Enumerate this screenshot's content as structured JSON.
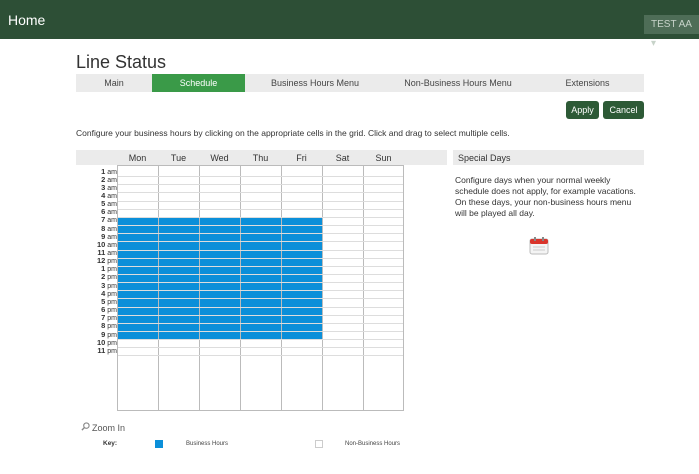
{
  "topbar": {
    "home": "Home",
    "user_menu": "TEST AA",
    "user_menu_caret": "▾"
  },
  "page": {
    "title": "Line Status"
  },
  "tabs": [
    {
      "label": "Main",
      "active": false
    },
    {
      "label": "Schedule",
      "active": true
    },
    {
      "label": "Business Hours Menu",
      "active": false
    },
    {
      "label": "Non-Business Hours Menu",
      "active": false
    },
    {
      "label": "Extensions",
      "active": false
    }
  ],
  "actions": {
    "apply": "Apply",
    "cancel": "Cancel"
  },
  "instructions": "Configure your business hours by clicking on the appropriate cells in the grid. Click and drag to select multiple cells.",
  "schedule": {
    "days": [
      "Mon",
      "Tue",
      "Wed",
      "Thu",
      "Fri",
      "Sat",
      "Sun"
    ],
    "hours": [
      {
        "n": "1",
        "s": "am"
      },
      {
        "n": "2",
        "s": "am"
      },
      {
        "n": "3",
        "s": "am"
      },
      {
        "n": "4",
        "s": "am"
      },
      {
        "n": "5",
        "s": "am"
      },
      {
        "n": "6",
        "s": "am"
      },
      {
        "n": "7",
        "s": "am"
      },
      {
        "n": "8",
        "s": "am"
      },
      {
        "n": "9",
        "s": "am"
      },
      {
        "n": "10",
        "s": "am"
      },
      {
        "n": "11",
        "s": "am"
      },
      {
        "n": "12",
        "s": "pm"
      },
      {
        "n": "1",
        "s": "pm"
      },
      {
        "n": "2",
        "s": "pm"
      },
      {
        "n": "3",
        "s": "pm"
      },
      {
        "n": "4",
        "s": "pm"
      },
      {
        "n": "5",
        "s": "pm"
      },
      {
        "n": "6",
        "s": "pm"
      },
      {
        "n": "7",
        "s": "pm"
      },
      {
        "n": "8",
        "s": "pm"
      },
      {
        "n": "9",
        "s": "pm"
      },
      {
        "n": "10",
        "s": "pm"
      },
      {
        "n": "11",
        "s": "pm"
      }
    ],
    "business_color": "#0b8fd9"
  },
  "special_days": {
    "title": "Special Days",
    "text": "Configure days when your normal weekly schedule does not apply, for example vacations. On these days, your non-business hours menu will be played all day.",
    "icon": "calendar-icon"
  },
  "zoom": {
    "label": "Zoom In",
    "icon": "magnifier-icon"
  },
  "key": {
    "label": "Key:",
    "business": "Business Hours",
    "non_business": "Non-Business Hours"
  },
  "colors": {
    "topbar": "#2d4f36",
    "tab_active": "#3a9a48",
    "button": "#2d5a36"
  }
}
